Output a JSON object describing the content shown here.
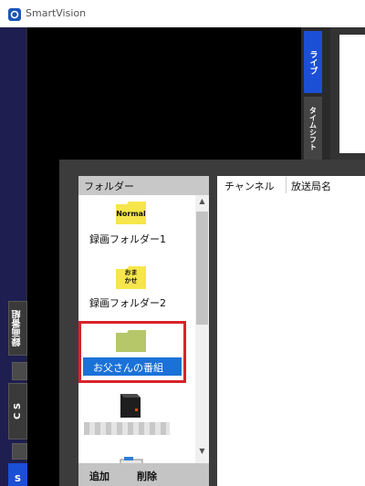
{
  "window": {
    "title": "SmartVision"
  },
  "side_tabs": {
    "recorded": "録画番組",
    "cs": "C S",
    "bottom": "S"
  },
  "video_tabs": {
    "live": "ライブ",
    "timeshift": "タイムシフト"
  },
  "folder_panel": {
    "header": "フォルダー",
    "items": [
      {
        "icon_text": "Normal",
        "label": "録画フォルダー1"
      },
      {
        "icon_text_1": "おま",
        "icon_text_2": "かせ",
        "label": "録画フォルダー2"
      },
      {
        "label": "お父さんの番組",
        "selected": true
      }
    ],
    "add_label": "追加",
    "delete_label": "削除"
  },
  "list_panel": {
    "columns": [
      "チャンネル",
      "放送局名"
    ]
  },
  "colors": {
    "selection": "#1a72d8",
    "highlight_border": "#d8232a",
    "tab_active": "#1b4fd6",
    "folder_green": "#b5c768",
    "folder_yellow": "#f6e64c"
  }
}
